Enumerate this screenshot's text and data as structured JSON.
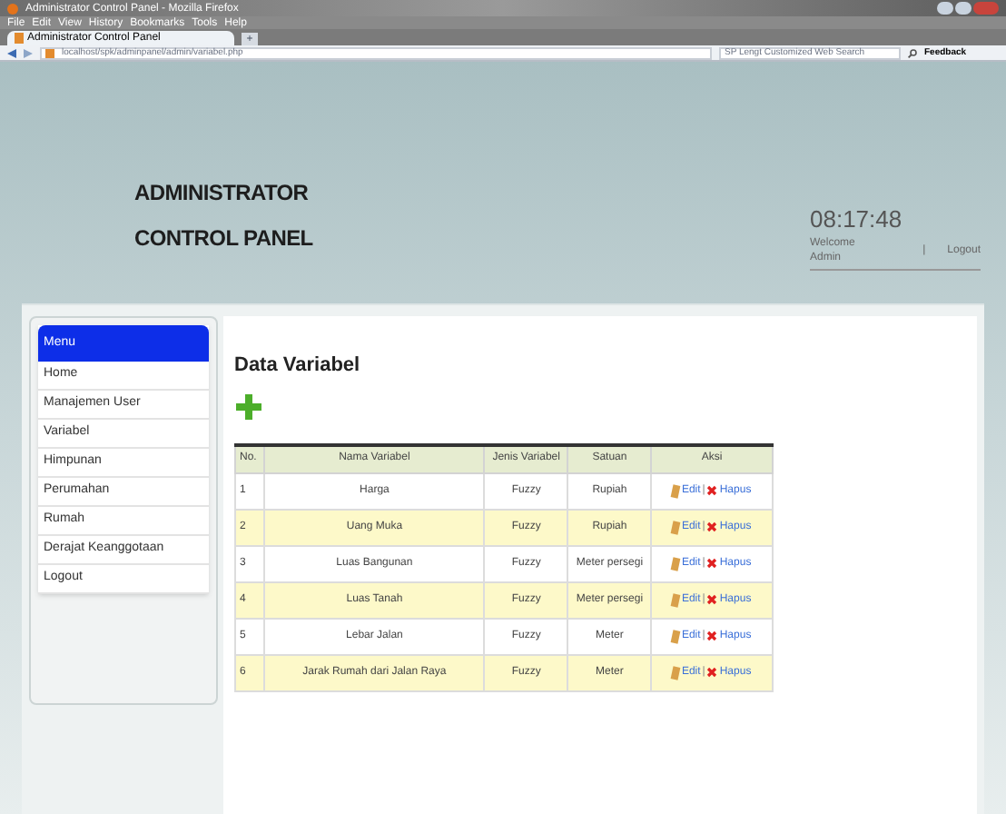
{
  "browser": {
    "window_title": "Administrator Control Panel - Mozilla Firefox",
    "menu": [
      "File",
      "Edit",
      "View",
      "History",
      "Bookmarks",
      "Tools",
      "Help"
    ],
    "tab": {
      "label": "Administrator Control Panel",
      "selected": true
    },
    "new_tab": "+",
    "url": "localhost/spk/adminpanel/admin/variabel.php",
    "search_placeholder": "SP Lengt Customized Web Search",
    "feedback": "Feedback"
  },
  "header": {
    "title_line_1": "ADMINISTRATOR",
    "title_line_2": "CONTROL PANEL",
    "clock": "08:17:48",
    "welcome": "Welcome Admin",
    "separator": "|",
    "logout": "Logout"
  },
  "sidebar": {
    "heading": "Menu",
    "items": [
      {
        "label": "Home"
      },
      {
        "label": "Manajemen User"
      },
      {
        "label": "Variabel"
      },
      {
        "label": "Himpunan"
      },
      {
        "label": "Perumahan"
      },
      {
        "label": "Rumah"
      },
      {
        "label": "Derajat Keanggotaan"
      },
      {
        "label": "Logout"
      }
    ]
  },
  "content": {
    "title": "Data Variabel",
    "table": {
      "columns": [
        "No.",
        "Nama Variabel",
        "Jenis Variabel",
        "Satuan",
        "Aksi"
      ],
      "rows": [
        {
          "no": "1",
          "name": "Harga",
          "type": "Fuzzy",
          "unit": "Rupiah",
          "edit": "Edit",
          "sep": "|",
          "delete": "Hapus"
        },
        {
          "no": "2",
          "name": "Uang Muka",
          "type": "Fuzzy",
          "unit": "Rupiah",
          "edit": "Edit",
          "sep": "|",
          "delete": "Hapus"
        },
        {
          "no": "3",
          "name": "Luas Bangunan",
          "type": "Fuzzy",
          "unit": "Meter persegi",
          "edit": "Edit",
          "sep": "|",
          "delete": "Hapus"
        },
        {
          "no": "4",
          "name": "Luas Tanah",
          "type": "Fuzzy",
          "unit": "Meter persegi",
          "edit": "Edit",
          "sep": "|",
          "delete": "Hapus"
        },
        {
          "no": "5",
          "name": "Lebar Jalan",
          "type": "Fuzzy",
          "unit": "Meter",
          "edit": "Edit",
          "sep": "|",
          "delete": "Hapus"
        },
        {
          "no": "6",
          "name": "Jarak Rumah dari Jalan Raya",
          "type": "Fuzzy",
          "unit": "Meter",
          "edit": "Edit",
          "sep": "|",
          "delete": "Hapus"
        }
      ]
    }
  }
}
